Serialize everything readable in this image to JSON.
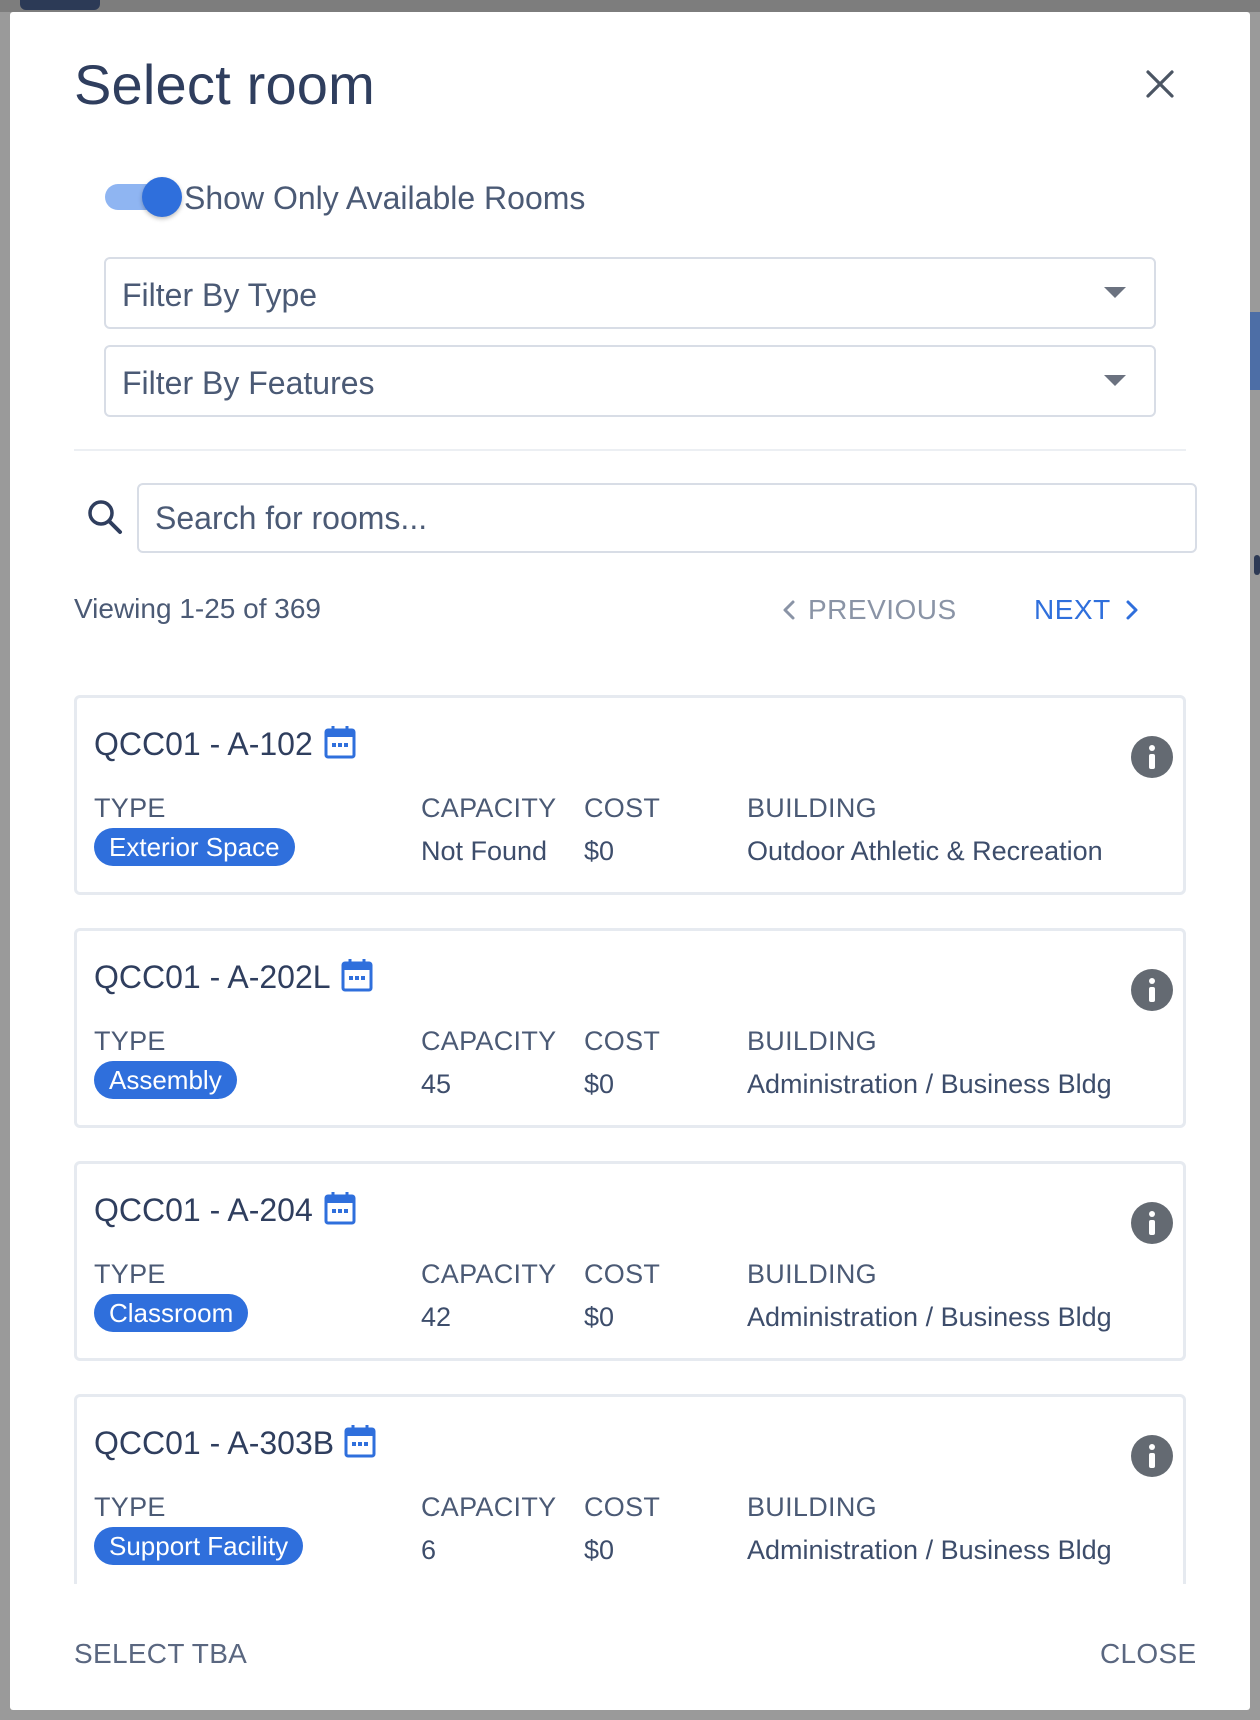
{
  "modal": {
    "title": "Select room",
    "close_icon": "close-icon"
  },
  "filters": {
    "toggle_label": "Show Only Available Rooms",
    "toggle_on": true,
    "type_placeholder": "Filter By Type",
    "features_placeholder": "Filter By Features"
  },
  "search": {
    "placeholder": "Search for rooms..."
  },
  "pagination": {
    "viewing": "Viewing 1-25 of 369",
    "previous_label": "PREVIOUS",
    "next_label": "NEXT"
  },
  "columns": {
    "type": "TYPE",
    "capacity": "CAPACITY",
    "cost": "COST",
    "building": "BUILDING"
  },
  "rooms": [
    {
      "name": "QCC01 - A-102",
      "type": "Exterior Space",
      "capacity": "Not Found",
      "cost": "$0",
      "building": "Outdoor Athletic & Recreation"
    },
    {
      "name": "QCC01 - A-202L",
      "type": "Assembly",
      "capacity": "45",
      "cost": "$0",
      "building": "Administration / Business Bldg"
    },
    {
      "name": "QCC01 - A-204",
      "type": "Classroom",
      "capacity": "42",
      "cost": "$0",
      "building": "Administration / Business Bldg"
    },
    {
      "name": "QCC01 - A-303B",
      "type": "Support Facility",
      "capacity": "6",
      "cost": "$0",
      "building": "Administration / Business Bldg"
    }
  ],
  "footer": {
    "select_tba": "SELECT TBA",
    "close": "CLOSE"
  },
  "colors": {
    "accent": "#2f6fdc",
    "title": "#2f3e5e",
    "text": "#4b5a75",
    "info_icon": "#646a72"
  }
}
